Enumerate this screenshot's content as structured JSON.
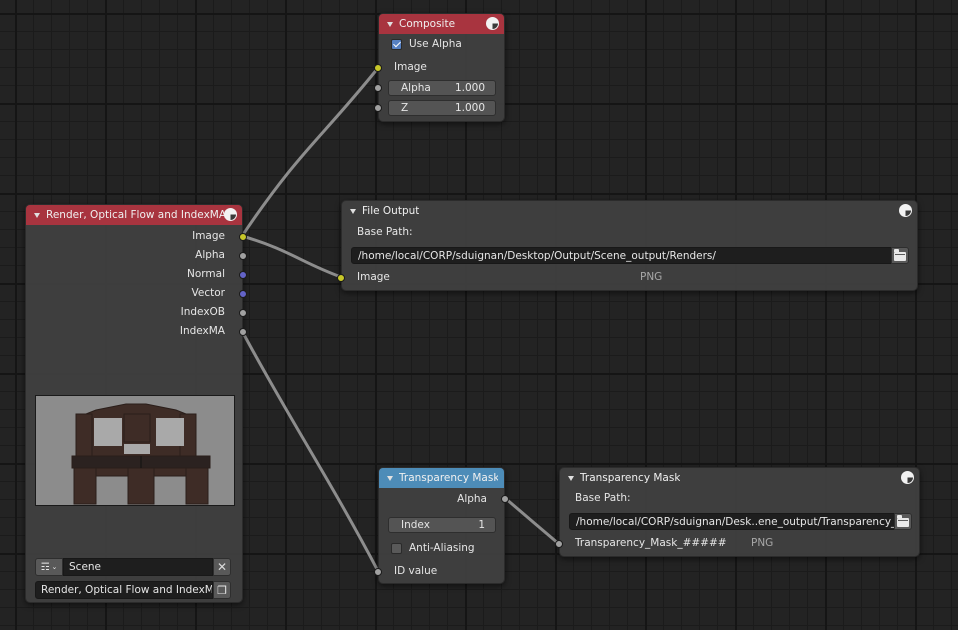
{
  "nodes": {
    "composite": {
      "title": "Composite",
      "header_color": "#a8343f",
      "use_alpha": {
        "label": "Use Alpha",
        "checked": true
      },
      "inputs": {
        "image": "Image",
        "alpha": {
          "label": "Alpha",
          "value": "1.000"
        },
        "z": {
          "label": "Z",
          "value": "1.000"
        }
      }
    },
    "render_layers": {
      "title": "Render, Optical Flow and IndexMA",
      "header_color": "#a8343f",
      "outputs": [
        "Image",
        "Alpha",
        "Normal",
        "Vector",
        "IndexOB",
        "IndexMA"
      ],
      "scene": {
        "value": "Scene"
      },
      "layer": {
        "value": "Render, Optical Flow and IndexMA.."
      }
    },
    "file_output": {
      "title": "File Output",
      "base_path_label": "Base Path:",
      "base_path": "/home/local/CORP/sduignan/Desktop/Output/Scene_output/Renders/",
      "input": {
        "label": "Image",
        "format": "PNG"
      }
    },
    "id_mask": {
      "title": "Transparency Mask..",
      "header_color": "#4d8cb8",
      "output": "Alpha",
      "index": {
        "label": "Index",
        "value": "1"
      },
      "anti_aliasing": {
        "label": "Anti-Aliasing",
        "checked": false
      },
      "input": "ID value"
    },
    "mask_output": {
      "title": "Transparency Mask",
      "base_path_label": "Base Path:",
      "base_path": "/home/local/CORP/sduignan/Desk..ene_output/Transparency_Mask/",
      "input": {
        "label": "Transparency_Mask_#####",
        "format": "PNG"
      }
    }
  },
  "links": [
    {
      "from": "render_layers.Image",
      "to": "composite.Image"
    },
    {
      "from": "render_layers.Image",
      "to": "file_output.Image"
    },
    {
      "from": "render_layers.IndexMA",
      "to": "id_mask.ID value"
    },
    {
      "from": "id_mask.Alpha",
      "to": "mask_output.Transparency_Mask_#####"
    }
  ],
  "socket_colors": {
    "color": "#c7c729",
    "value": "#a1a1a1",
    "vector": "#6363c7"
  }
}
